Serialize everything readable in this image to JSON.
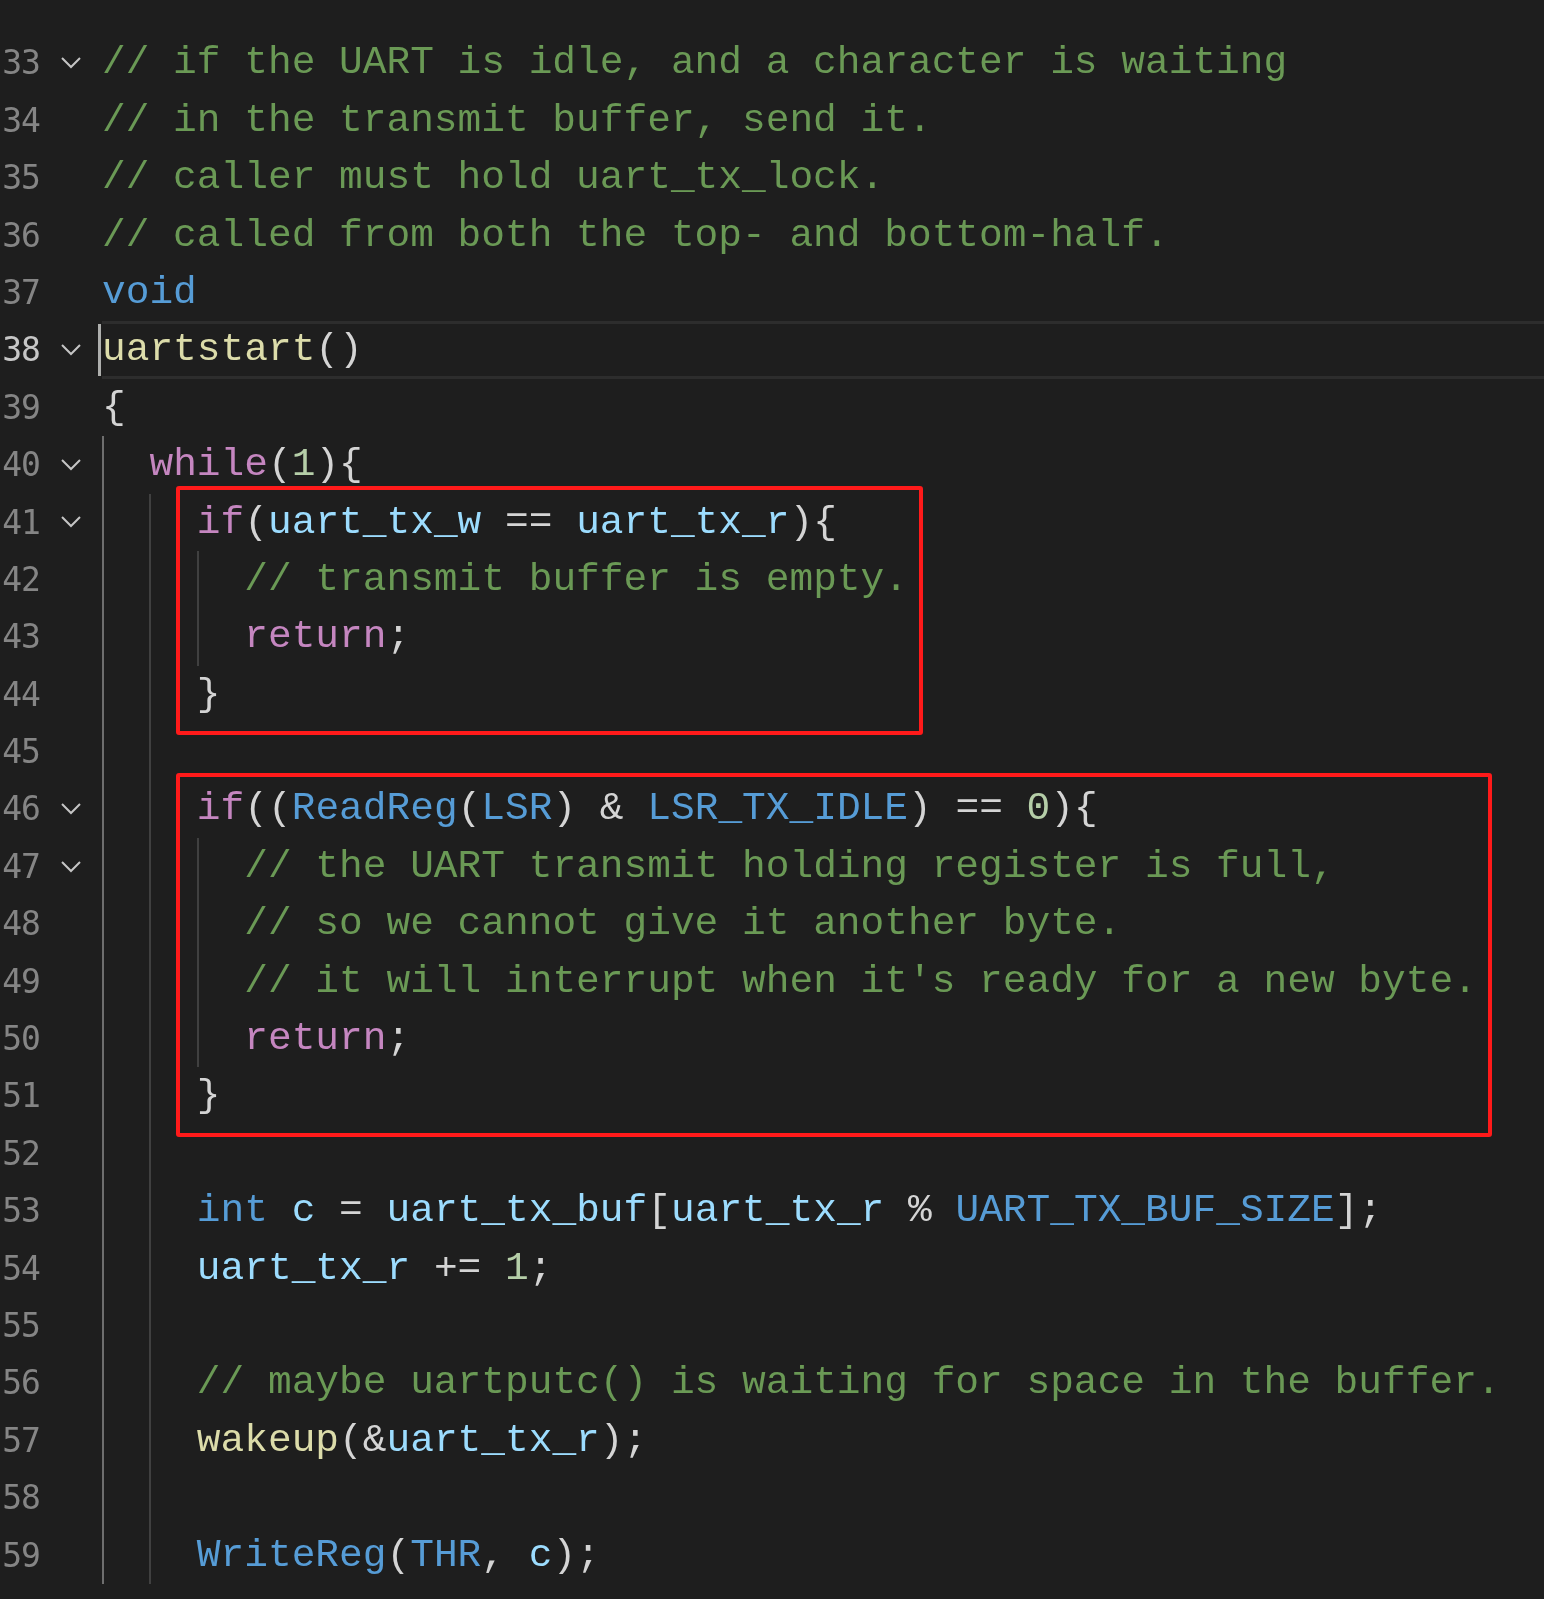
{
  "editor": {
    "lines": [
      {
        "kind": "line",
        "number": "33",
        "foldable": true,
        "expanded": true,
        "current": false,
        "tokens": [
          {
            "kind": "comment",
            "text": "// if the UART is idle, and a character is waiting"
          }
        ]
      },
      {
        "kind": "line",
        "number": "34",
        "foldable": false,
        "current": false,
        "tokens": [
          {
            "kind": "comment",
            "text": "// in the transmit buffer, send it."
          }
        ]
      },
      {
        "kind": "line",
        "number": "35",
        "foldable": false,
        "current": false,
        "tokens": [
          {
            "kind": "comment",
            "text": "// caller must hold uart_tx_lock."
          }
        ]
      },
      {
        "kind": "line",
        "number": "36",
        "foldable": false,
        "current": false,
        "tokens": [
          {
            "kind": "comment",
            "text": "// called from both the top- and bottom-half."
          }
        ]
      },
      {
        "kind": "line",
        "number": "37",
        "foldable": false,
        "current": false,
        "tokens": [
          {
            "kind": "type",
            "text": "void"
          }
        ]
      },
      {
        "kind": "line",
        "number": "38",
        "foldable": true,
        "expanded": true,
        "current": true,
        "tokens": [
          {
            "kind": "function",
            "text": "uartstart"
          },
          {
            "kind": "plain",
            "text": "()"
          }
        ]
      },
      {
        "kind": "line",
        "number": "39",
        "foldable": false,
        "current": false,
        "tokens": [
          {
            "kind": "plain",
            "text": "{"
          }
        ]
      },
      {
        "kind": "line",
        "number": "40",
        "foldable": true,
        "expanded": true,
        "current": false,
        "tokens": [
          {
            "kind": "keyword",
            "text": "  while"
          },
          {
            "kind": "plain",
            "text": "("
          },
          {
            "kind": "number",
            "text": "1"
          },
          {
            "kind": "plain",
            "text": "){"
          }
        ]
      },
      {
        "kind": "highlight_box",
        "lines": [
          {
            "kind": "line",
            "number": "41",
            "foldable": true,
            "expanded": true,
            "current": false,
            "tokens": [
              {
                "kind": "keyword",
                "text": "    if"
              },
              {
                "kind": "plain",
                "text": "("
              },
              {
                "kind": "variable",
                "text": "uart_tx_w"
              },
              {
                "kind": "plain",
                "text": " == "
              },
              {
                "kind": "variable",
                "text": "uart_tx_r"
              },
              {
                "kind": "plain",
                "text": "){"
              }
            ]
          },
          {
            "kind": "line",
            "number": "42",
            "foldable": false,
            "current": false,
            "tokens": [
              {
                "kind": "comment",
                "text": "      // transmit buffer is empty."
              }
            ]
          },
          {
            "kind": "line",
            "number": "43",
            "foldable": false,
            "current": false,
            "tokens": [
              {
                "kind": "keyword",
                "text": "      return"
              },
              {
                "kind": "plain",
                "text": ";"
              }
            ]
          },
          {
            "kind": "line",
            "number": "44",
            "foldable": false,
            "current": false,
            "tokens": [
              {
                "kind": "plain",
                "text": "    }"
              }
            ]
          }
        ]
      },
      {
        "kind": "line",
        "number": "45",
        "foldable": false,
        "current": false
      },
      {
        "kind": "highlight_box",
        "lines": [
          {
            "kind": "line",
            "number": "46",
            "foldable": true,
            "expanded": true,
            "current": false,
            "tokens": [
              {
                "kind": "keyword",
                "text": "    if"
              },
              {
                "kind": "plain",
                "text": "(("
              },
              {
                "kind": "macro",
                "text": "ReadReg"
              },
              {
                "kind": "plain",
                "text": "("
              },
              {
                "kind": "macro",
                "text": "LSR"
              },
              {
                "kind": "plain",
                "text": ") & "
              },
              {
                "kind": "macro",
                "text": "LSR_TX_IDLE"
              },
              {
                "kind": "plain",
                "text": ") == "
              },
              {
                "kind": "number",
                "text": "0"
              },
              {
                "kind": "plain",
                "text": "){"
              }
            ]
          },
          {
            "kind": "line",
            "number": "47",
            "foldable": true,
            "expanded": true,
            "current": false,
            "tokens": [
              {
                "kind": "comment",
                "text": "      // the UART transmit holding register is full,"
              }
            ]
          },
          {
            "kind": "line",
            "number": "48",
            "foldable": false,
            "current": false,
            "tokens": [
              {
                "kind": "comment",
                "text": "      // so we cannot give it another byte."
              }
            ]
          },
          {
            "kind": "line",
            "number": "49",
            "foldable": false,
            "current": false,
            "tokens": [
              {
                "kind": "comment",
                "text": "      // it will interrupt when it's ready for a new byte."
              }
            ]
          },
          {
            "kind": "line",
            "number": "50",
            "foldable": false,
            "current": false,
            "tokens": [
              {
                "kind": "keyword",
                "text": "      return"
              },
              {
                "kind": "plain",
                "text": ";"
              }
            ]
          },
          {
            "kind": "line",
            "number": "51",
            "foldable": false,
            "current": false,
            "tokens": [
              {
                "kind": "plain",
                "text": "    }"
              }
            ]
          }
        ]
      },
      {
        "kind": "line",
        "number": "52",
        "foldable": false,
        "current": false
      },
      {
        "kind": "line",
        "number": "53",
        "foldable": false,
        "current": false,
        "tokens": [
          {
            "kind": "type",
            "text": "    int "
          },
          {
            "kind": "variable",
            "text": "c"
          },
          {
            "kind": "plain",
            "text": " = "
          },
          {
            "kind": "variable",
            "text": "uart_tx_buf"
          },
          {
            "kind": "plain",
            "text": "["
          },
          {
            "kind": "variable",
            "text": "uart_tx_r"
          },
          {
            "kind": "plain",
            "text": " % "
          },
          {
            "kind": "macro",
            "text": "UART_TX_BUF_SIZE"
          },
          {
            "kind": "plain",
            "text": "];"
          }
        ]
      },
      {
        "kind": "line",
        "number": "54",
        "foldable": false,
        "current": false,
        "tokens": [
          {
            "kind": "variable",
            "text": "    uart_tx_r"
          },
          {
            "kind": "plain",
            "text": " += "
          },
          {
            "kind": "number",
            "text": "1"
          },
          {
            "kind": "plain",
            "text": ";"
          }
        ]
      },
      {
        "kind": "line",
        "number": "55",
        "foldable": false,
        "current": false
      },
      {
        "kind": "line",
        "number": "56",
        "foldable": false,
        "current": false,
        "tokens": [
          {
            "kind": "comment",
            "text": "    // maybe uartputc() is waiting for space in the buffer."
          }
        ]
      },
      {
        "kind": "line",
        "number": "57",
        "foldable": false,
        "current": false,
        "tokens": [
          {
            "kind": "function",
            "text": "    wakeup"
          },
          {
            "kind": "plain",
            "text": "(&"
          },
          {
            "kind": "variable",
            "text": "uart_tx_r"
          },
          {
            "kind": "plain",
            "text": ");"
          }
        ]
      },
      {
        "kind": "line",
        "number": "58",
        "foldable": false,
        "current": false
      },
      {
        "kind": "line",
        "number": "59",
        "foldable": false,
        "current": false,
        "tokens": [
          {
            "kind": "macro",
            "text": "    WriteReg"
          },
          {
            "kind": "plain",
            "text": "("
          },
          {
            "kind": "macro",
            "text": "THR"
          },
          {
            "kind": "plain",
            "text": ", "
          },
          {
            "kind": "variable",
            "text": "c"
          },
          {
            "kind": "plain",
            "text": ");"
          }
        ]
      }
    ]
  }
}
